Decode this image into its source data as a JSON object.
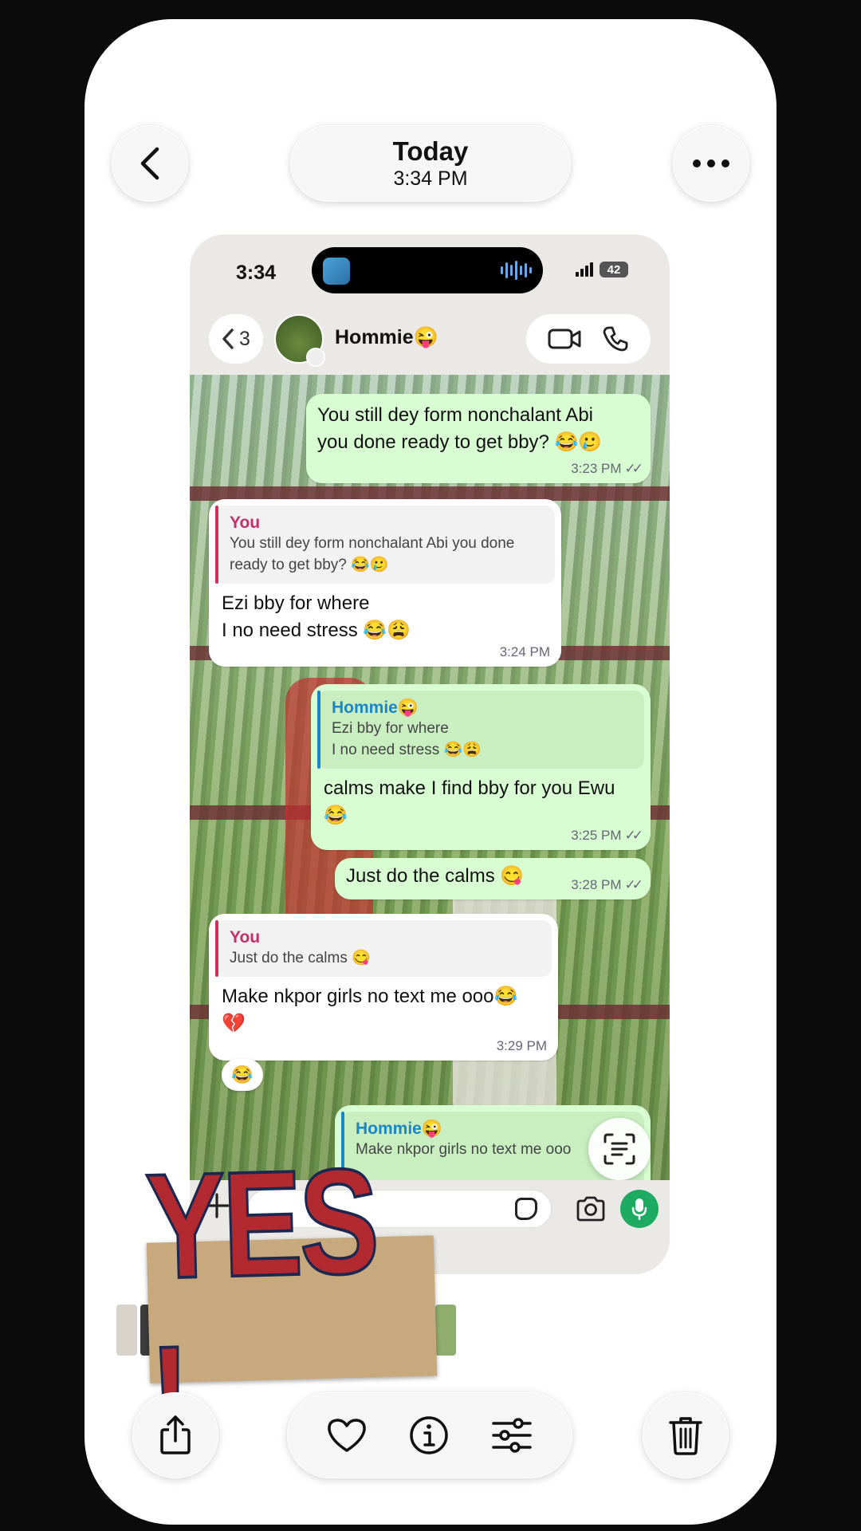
{
  "viewer": {
    "date_title": "Today",
    "date_time": "3:34 PM"
  },
  "status_bar": {
    "time": "3:34",
    "battery": "42"
  },
  "chat_header": {
    "back_count": "3",
    "contact_name": "Hommie😜"
  },
  "messages": [
    {
      "direction": "out",
      "text": "You still dey form nonchalant Abi\nyou done ready to get bby?  😂🥲",
      "time": "3:23 PM",
      "ticks": "✓✓"
    },
    {
      "direction": "in",
      "quote_author": "You",
      "quote_text": "You still dey form nonchalant Abi you done\nready to get bby?  😂🥲",
      "text": "Ezi bby for where\nI no need stress 😂😩",
      "time": "3:24 PM"
    },
    {
      "direction": "out",
      "quote_author": "Hommie😜",
      "quote_text": "Ezi bby for where\nI no need stress 😂😩",
      "text": "calms make I find bby for you Ewu\n😂",
      "time": "3:25 PM",
      "ticks": "✓✓"
    },
    {
      "direction": "out",
      "text": "Just do the calms 😋",
      "time": "3:28 PM",
      "ticks": "✓✓"
    },
    {
      "direction": "in",
      "quote_author": "You",
      "quote_text": "Just do the calms 😋",
      "text": "Make nkpor girls no text me ooo😂\n💔",
      "time": "3:29 PM",
      "reaction": "😂"
    },
    {
      "direction": "out",
      "quote_author": "Hommie😜",
      "quote_text": "Make nkpor girls no text me ooo"
    }
  ],
  "sticker": {
    "text": "YES !"
  },
  "icons": {
    "back": "chevron-left-icon",
    "more": "more-horizontal-icon",
    "video": "video-camera-icon",
    "phone": "phone-icon",
    "share": "share-icon",
    "favorite": "heart-icon",
    "info": "info-icon",
    "adjust": "sliders-icon",
    "delete": "trash-icon",
    "scan": "live-text-icon",
    "mic": "microphone-icon",
    "camera": "camera-icon",
    "sticker": "sticker-icon",
    "add": "plus-icon"
  },
  "colors": {
    "outgoing_bubble": "#d9fdd3",
    "incoming_bubble": "#ffffff",
    "mic_button": "#1daa61",
    "quote_you": "#c0306a",
    "quote_hommie": "#1a86c7"
  }
}
